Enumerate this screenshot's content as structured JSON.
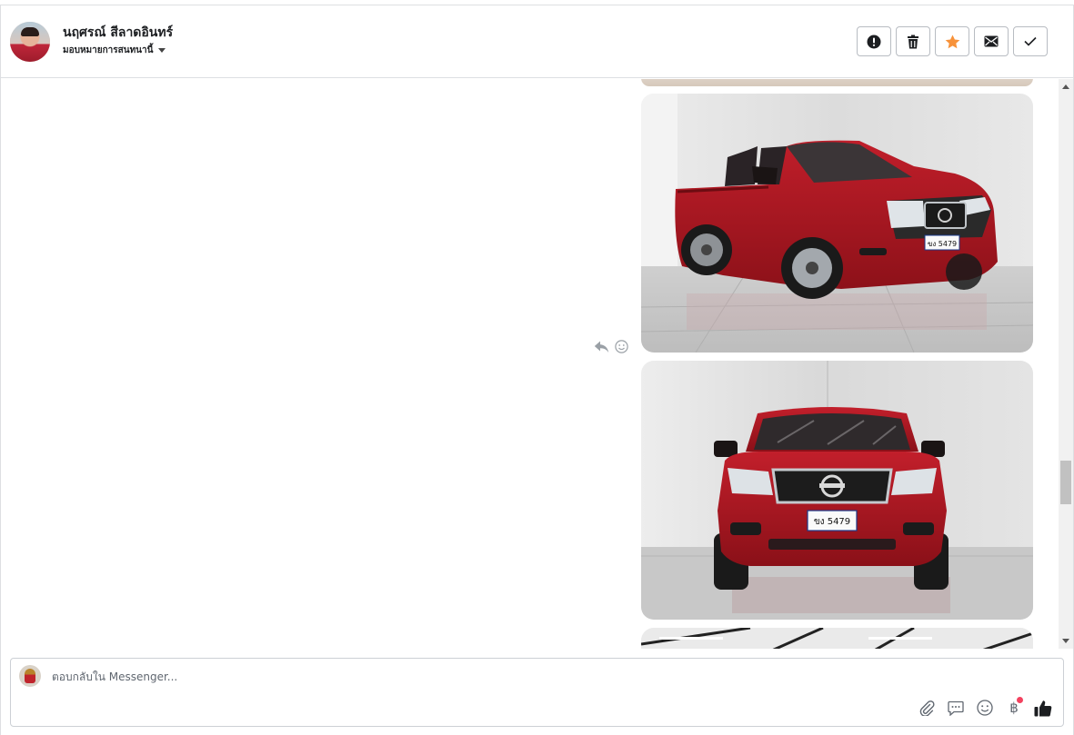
{
  "header": {
    "contact_name": "นฤศรณ์ สีลาดอินทร์",
    "assign_label": "มอบหมายการสนทนานี้",
    "actions": [
      {
        "name": "mark-spam-button",
        "icon": "alert-circle-icon"
      },
      {
        "name": "delete-button",
        "icon": "trash-icon"
      },
      {
        "name": "star-button",
        "icon": "star-icon",
        "color": "#f7923a"
      },
      {
        "name": "mark-unread-button",
        "icon": "envelope-icon"
      },
      {
        "name": "mark-done-button",
        "icon": "check-icon"
      }
    ]
  },
  "conversation": {
    "images": [
      {
        "subject": "red pickup truck, front three-quarter view",
        "plate": "ขง 5479"
      },
      {
        "subject": "red pickup truck, front view",
        "plate": "ขง 5479"
      }
    ],
    "message_tools": [
      "reply-icon",
      "emoji-reaction-icon"
    ]
  },
  "composer": {
    "placeholder": "ตอบกลับใน Messenger...",
    "tools": [
      "paperclip-icon",
      "saved-reply-icon",
      "emoji-icon",
      "baht-payment-icon",
      "thumbs-up-icon"
    ],
    "payment_symbol": "฿",
    "badge_color": "#f3425f"
  }
}
